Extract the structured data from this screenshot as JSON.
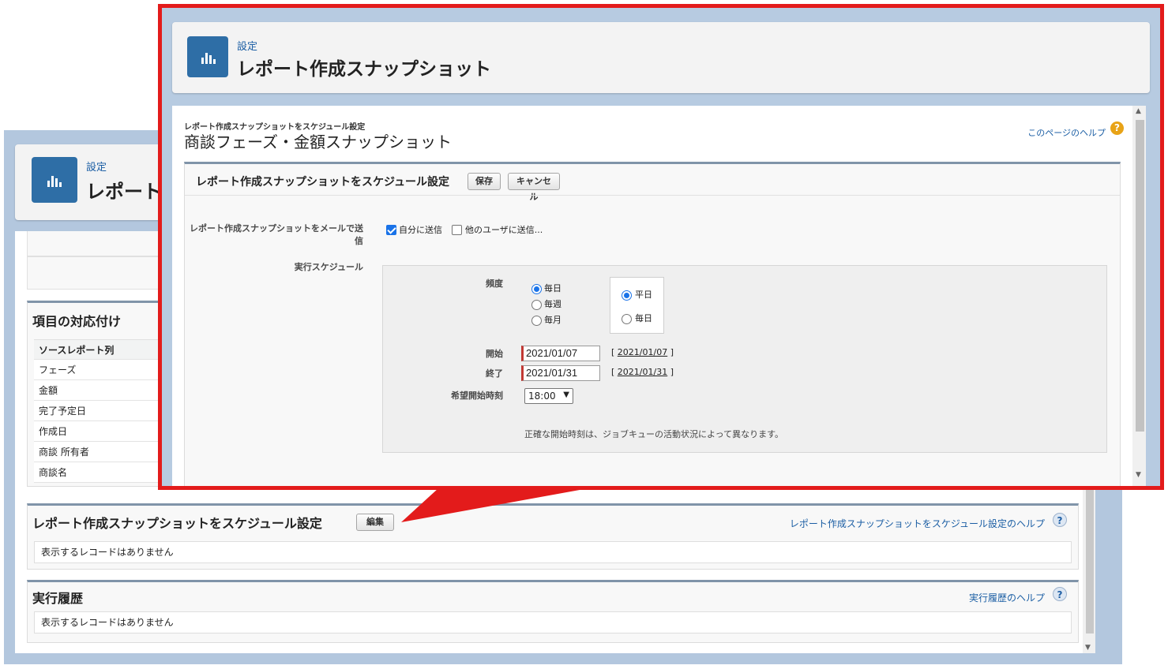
{
  "background": {
    "header": {
      "breadcrumb": "設定",
      "title": "レポート"
    },
    "mapping": {
      "title": "項目の対応付け",
      "column_header": "ソースレポート列",
      "rows": [
        "フェーズ",
        "金額",
        "完了予定日",
        "作成日",
        "商談 所有者",
        "商談名"
      ]
    },
    "schedule": {
      "title": "レポート作成スナップショットをスケジュール設定",
      "edit_label": "編集",
      "help_label": "レポート作成スナップショットをスケジュール設定のヘルプ",
      "empty": "表示するレコードはありません"
    },
    "history": {
      "title": "実行履歴",
      "help_label": "実行履歴のヘルプ",
      "empty": "表示するレコードはありません"
    }
  },
  "foreground": {
    "header": {
      "breadcrumb": "設定",
      "title": "レポート作成スナップショット"
    },
    "page": {
      "supertitle": "レポート作成スナップショットをスケジュール設定",
      "title": "商談フェーズ・金額スナップショット",
      "help_label": "このページのヘルプ"
    },
    "form": {
      "section_title": "レポート作成スナップショットをスケジュール設定",
      "save_label": "保存",
      "cancel_label": "キャンセル",
      "email_label": "レポート作成スナップショットをメールで送信",
      "send_self_label": "自分に送信",
      "send_self_checked": true,
      "send_others_label": "他のユーザに送信...",
      "send_others_checked": false,
      "schedule_label": "実行スケジュール",
      "frequency_label": "頻度",
      "frequency_options": [
        "毎日",
        "毎週",
        "毎月"
      ],
      "frequency_selected": "毎日",
      "daily_options": [
        "平日",
        "毎日"
      ],
      "daily_selected": "平日",
      "start_label": "開始",
      "start_value": "2021/01/07",
      "start_link": "2021/01/07",
      "end_label": "終了",
      "end_value": "2021/01/31",
      "end_link": "2021/01/31",
      "preferred_time_label": "希望開始時刻",
      "preferred_time_value": "18:00",
      "note": "正確な開始時刻は、ジョブキューの活動状況によって異なります。"
    }
  },
  "colors": {
    "callout_red": "#e31b1b",
    "app_icon": "#2e6ea6",
    "link_blue": "#1b5ea4",
    "backdrop_blue": "#b3c7de"
  }
}
